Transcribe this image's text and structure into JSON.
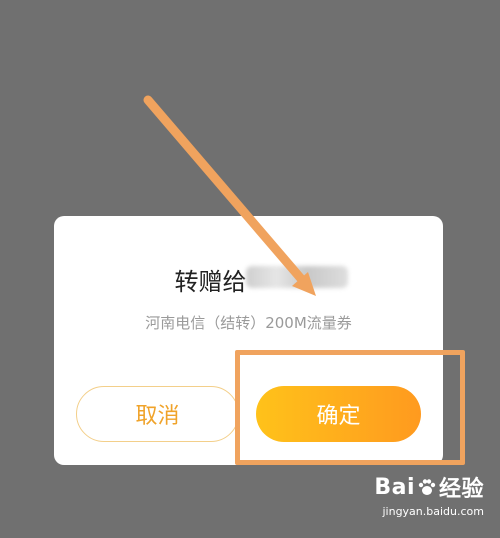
{
  "dialog": {
    "title": "转赠给",
    "subtitle": "河南电信（结转）200M流量券",
    "cancel_label": "取消",
    "confirm_label": "确定"
  },
  "annotation": {
    "arrow_color": "#f0a35e",
    "box_color": "#f0a35e"
  },
  "watermark": {
    "brand_left": "Bai",
    "brand_right": "经验",
    "url": "jingyan.baidu.com"
  },
  "colors": {
    "overlay": "#707070",
    "cancel_text": "#f0a32a",
    "confirm_start": "#ffc21a",
    "confirm_end": "#ff9a1f"
  }
}
